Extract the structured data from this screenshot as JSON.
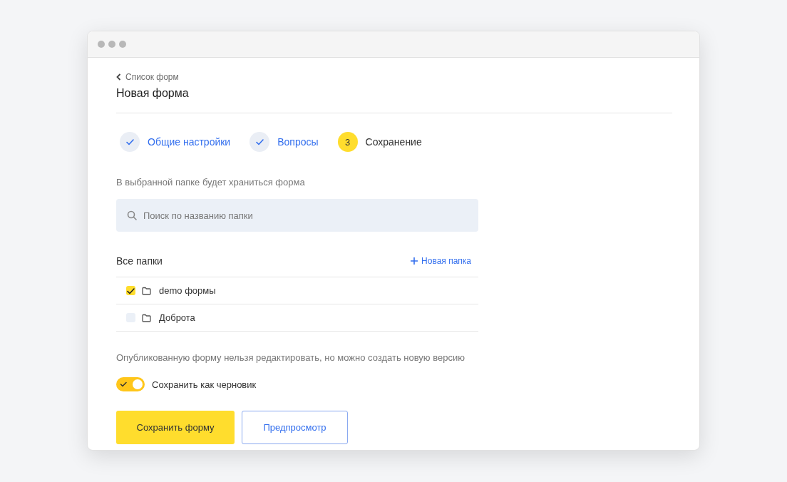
{
  "back_link": "Список форм",
  "title": "Новая форма",
  "steps": [
    {
      "label": "Общие настройки",
      "done": true
    },
    {
      "label": "Вопросы",
      "done": true
    },
    {
      "label": "Сохранение",
      "number": "3",
      "done": false
    }
  ],
  "folder_hint": "В выбранной папке будет храниться форма",
  "search": {
    "placeholder": "Поиск по названию папки"
  },
  "folders_header": "Все папки",
  "new_folder": "Новая папка",
  "folders": [
    {
      "name": "demo формы",
      "checked": true
    },
    {
      "name": "Доброта",
      "checked": false
    }
  ],
  "publish_note": "Опубликованную форму нельзя редактировать, но можно создать новую версию",
  "draft_toggle": {
    "label": "Сохранить как черновик",
    "on": true
  },
  "buttons": [
    {
      "label": "Сохранить форму",
      "kind": "primary"
    },
    {
      "label": "Предпросмотр",
      "kind": "secondary"
    }
  ]
}
